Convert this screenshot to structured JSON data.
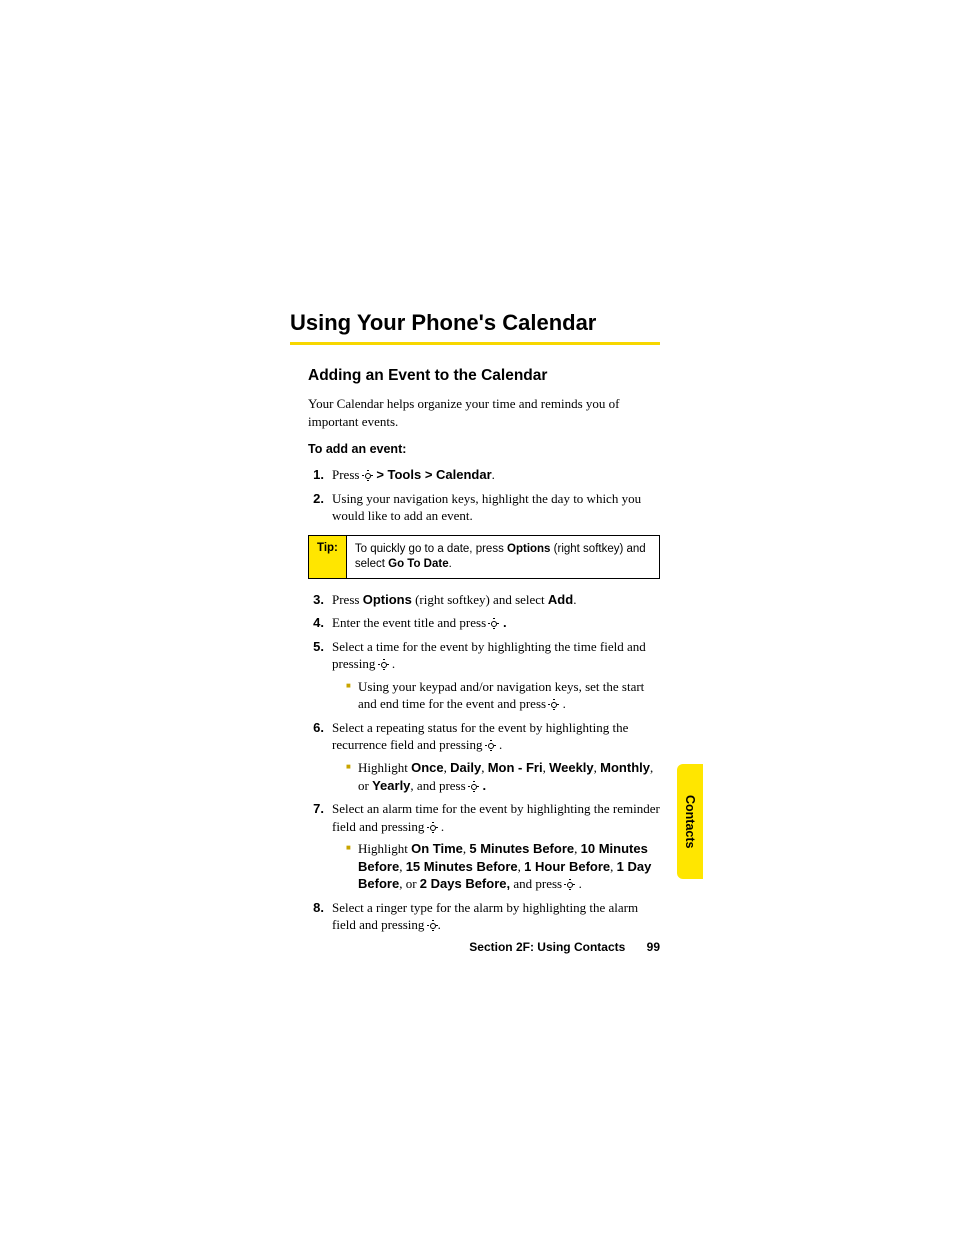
{
  "heading": "Using Your Phone's Calendar",
  "subheading": "Adding an Event to the Calendar",
  "intro": "Your Calendar helps organize your time and reminds you of important events.",
  "lead": "To add an event:",
  "steps": {
    "s1": {
      "num": "1.",
      "pre": "Press ",
      "post": " > Tools > Calendar",
      "end": "."
    },
    "s2": {
      "num": "2.",
      "text": "Using your navigation keys, highlight the day to which you would like to add an event."
    },
    "s3": {
      "num": "3.",
      "t1": "Press ",
      "b1": "Options",
      "t2": " (right softkey) and select ",
      "b2": "Add",
      "t3": "."
    },
    "s4": {
      "num": "4.",
      "t1": "Enter the event title and press ",
      "t2": " ."
    },
    "s5": {
      "num": "5.",
      "t1": "Select a time for the event by highlighting the time field and pressing ",
      "t2": " .",
      "sub": {
        "t1": "Using your keypad and/or navigation keys, set the start and end time for the event and press ",
        "t2": " ."
      }
    },
    "s6": {
      "num": "6.",
      "t1": "Select a repeating status for the event by highlighting the recurrence field and pressing ",
      "t2": " .",
      "sub": {
        "t1": "Highlight ",
        "b1": "Once",
        "c": ", ",
        "b2": "Daily",
        "b3": "Mon - Fri",
        "b4": "Weekly",
        "b5": "Monthly",
        "or": ", or ",
        "b6": "Yearly",
        "t2": ", and press ",
        "t3": " ."
      }
    },
    "s7": {
      "num": "7.",
      "t1": "Select an alarm time for the event by highlighting the reminder field and pressing ",
      "t2": " .",
      "sub": {
        "t1": "Highlight ",
        "b1": "On Time",
        "c": ", ",
        "b2": "5 Minutes Before",
        "b3": "10 Minutes Before",
        "b4": "15 Minutes Before",
        "b5": "1 Hour Before",
        "b6": "1 Day Before",
        "or": ", or ",
        "b7": "2 Days Before,",
        "t2": " and press ",
        "t3": " ."
      }
    },
    "s8": {
      "num": "8.",
      "t1": "Select a ringer type for the alarm by highlighting the alarm field and pressing ",
      "t2": "."
    }
  },
  "tip": {
    "label": "Tip:",
    "t1": "To quickly go to a date, press ",
    "b1": "Options",
    "t2": " (right softkey) and select ",
    "b2": "Go To Date",
    "t3": "."
  },
  "sidetab": "Contacts",
  "footer": {
    "section": "Section 2F: Using Contacts",
    "page": "99"
  }
}
